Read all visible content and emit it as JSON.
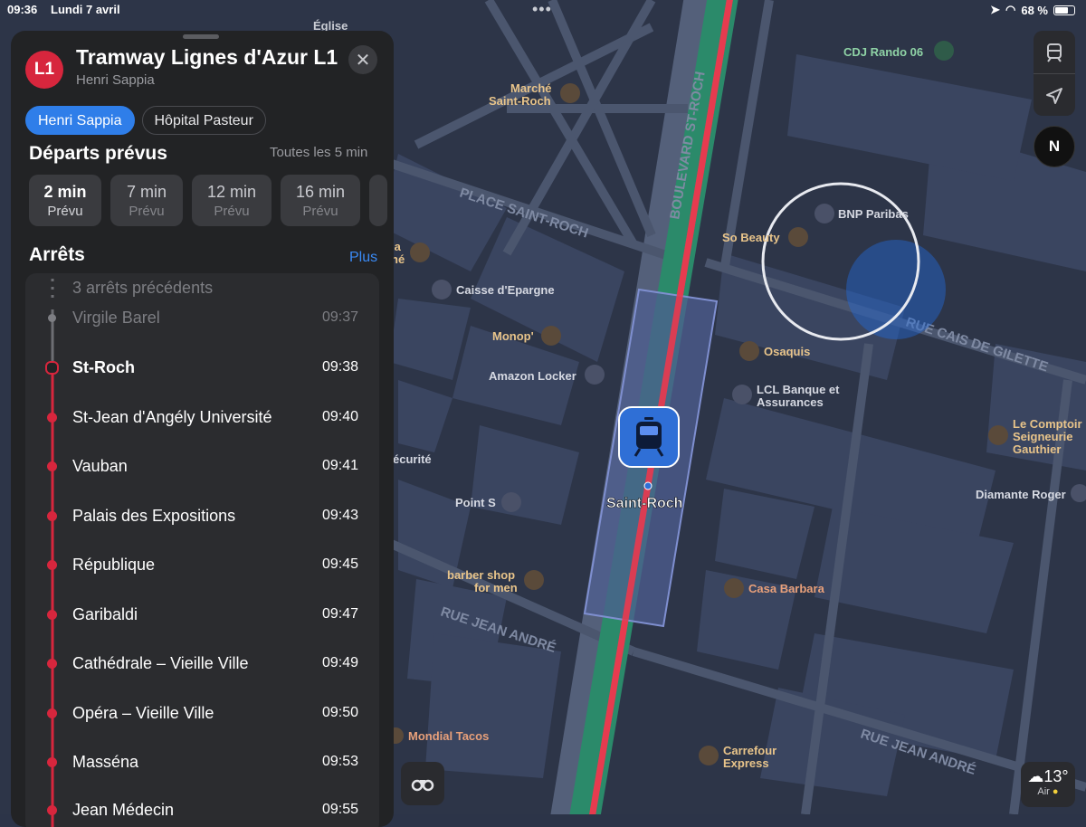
{
  "status": {
    "time": "09:36",
    "date": "Lundi 7 avril",
    "battery": "68 %"
  },
  "line": {
    "badge": "L1",
    "title": "Tramway Lignes d'Azur L1",
    "subtitle": "Henri Sappia",
    "badge_color": "#d7263d",
    "close_icon": "close-icon"
  },
  "directions": [
    {
      "label": "Henri Sappia",
      "active": true
    },
    {
      "label": "Hôpital Pasteur",
      "active": false
    }
  ],
  "departures": {
    "title": "Départs prévus",
    "frequency": "Toutes les 5 min",
    "items": [
      {
        "time": "2 min",
        "status": "Prévu"
      },
      {
        "time": "7 min",
        "status": "Prévu"
      },
      {
        "time": "12 min",
        "status": "Prévu"
      },
      {
        "time": "16 min",
        "status": "Prévu"
      }
    ]
  },
  "stops_section": {
    "title": "Arrêts",
    "more": "Plus"
  },
  "stops": [
    {
      "name": "3 arrêts précédents",
      "time": "",
      "state": "collapsed"
    },
    {
      "name": "Virgile Barel",
      "time": "09:37",
      "state": "past"
    },
    {
      "name": "St-Roch",
      "time": "09:38",
      "state": "current"
    },
    {
      "name": "St-Jean d'Angély Université",
      "time": "09:40",
      "state": "next"
    },
    {
      "name": "Vauban",
      "time": "09:41",
      "state": "next"
    },
    {
      "name": "Palais des Expositions",
      "time": "09:43",
      "state": "next"
    },
    {
      "name": "République",
      "time": "09:45",
      "state": "next"
    },
    {
      "name": "Garibaldi",
      "time": "09:47",
      "state": "next"
    },
    {
      "name": "Cathédrale – Vieille Ville",
      "time": "09:49",
      "state": "next"
    },
    {
      "name": "Opéra – Vieille Ville",
      "time": "09:50",
      "state": "next"
    },
    {
      "name": "Masséna",
      "time": "09:53",
      "state": "next"
    },
    {
      "name": "Jean Médecin",
      "time": "09:55",
      "state": "next"
    }
  ],
  "map": {
    "station": "Saint-Roch",
    "streets": [
      "BOULEVARD ST-ROCH",
      "PLACE SAINT-ROCH",
      "RUE CAIS DE GILETTE",
      "RUE JEAN ANDRÉ",
      "RUE JEAN ANDRÉ"
    ],
    "pois": [
      "Église",
      "CDJ Rando 06",
      "Marché Saint-Roch",
      "BNP Paribas",
      "So Beauty",
      "Caisse d'Epargne",
      "Monop'",
      "Osaquis",
      "Amazon Locker",
      "LCL Banque et Assurances",
      "Le Comptoir Seigneurie Gauthier",
      "écurité",
      "Point S",
      "Diamante Roger",
      "barber shop for men",
      "Casa Barbara",
      "Mondial Tacos",
      "Carrefour Express",
      "la",
      "né"
    ]
  },
  "weather": {
    "temp": "13°",
    "label": "Air"
  }
}
